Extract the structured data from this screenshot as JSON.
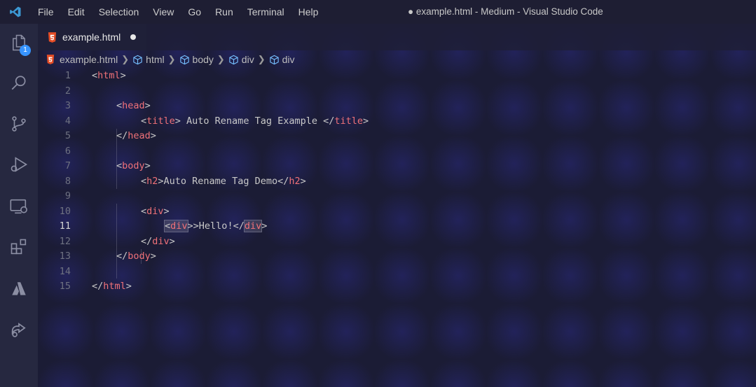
{
  "titlebar": {
    "menu": [
      "File",
      "Edit",
      "Selection",
      "View",
      "Go",
      "Run",
      "Terminal",
      "Help"
    ],
    "window_title": "● example.html - Medium - Visual Studio Code"
  },
  "activitybar": {
    "explorer_badge": "1",
    "icons": [
      "explorer-icon",
      "search-icon",
      "source-control-icon",
      "run-debug-icon",
      "remote-explorer-icon",
      "extensions-icon",
      "azure-icon",
      "live-share-icon"
    ]
  },
  "tab": {
    "label": "example.html"
  },
  "breadcrumb": [
    "example.html",
    "html",
    "body",
    "div",
    "div"
  ],
  "editor": {
    "active_line": 11,
    "line_numbers": [
      "1",
      "2",
      "3",
      "4",
      "5",
      "6",
      "7",
      "8",
      "9",
      "10",
      "11",
      "12",
      "13",
      "14",
      "15"
    ],
    "code": {
      "l1_open": "<",
      "l1_tag": "html",
      "l1_close": ">",
      "l3_open": "<",
      "l3_tag": "head",
      "l3_close": ">",
      "l4_open": "<",
      "l4_tag": "title",
      "l4_mid": "> Auto Rename Tag Example </",
      "l4_tag2": "title",
      "l4_close": ">",
      "l5_open": "</",
      "l5_tag": "head",
      "l5_close": ">",
      "l7_open": "<",
      "l7_tag": "body",
      "l7_close": ">",
      "l8_open": "<",
      "l8_tag": "h2",
      "l8_mid": ">Auto Rename Tag Demo</",
      "l8_tag2": "h2",
      "l8_close": ">",
      "l10_open": "<",
      "l10_tag": "div",
      "l10_close": ">",
      "l11_open": "<",
      "l11_tag": "div",
      "l11_mid": ">Hello!</",
      "l11_tag2": "div",
      "l11_close": ">",
      "l12_open": "</",
      "l12_tag": "div",
      "l12_close": ">",
      "l13_open": "</",
      "l13_tag": "body",
      "l13_close": ">",
      "l15_open": "</",
      "l15_tag": "html",
      "l15_close": ">"
    }
  },
  "colors": {
    "tag": "#f07178",
    "accent": "#3794ff",
    "html_icon": "#e44d26",
    "cube_icon": "#75beff"
  }
}
